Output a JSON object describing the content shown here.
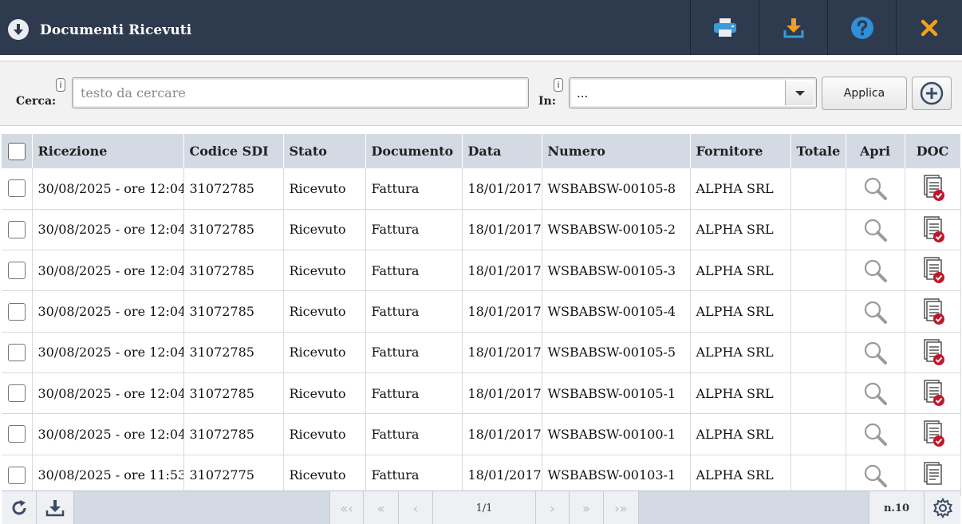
{
  "window": {
    "title": "Documenti Ricevuti",
    "buttons": [
      "print-icon",
      "download-icon",
      "help-icon",
      "close-icon"
    ]
  },
  "search": {
    "label": "Cerca:",
    "info": "i",
    "placeholder": "testo da cercare",
    "value": "",
    "in_label": "In:",
    "in_info": "i",
    "in_value": "...",
    "apply_label": "Applica"
  },
  "table": {
    "columns": [
      "Ricezione",
      "Codice SDI",
      "Stato",
      "Documento",
      "Data",
      "Numero",
      "Fornitore",
      "Totale",
      "Apri",
      "DOC"
    ],
    "rows": [
      {
        "ricezione": "30/08/2025 - ore 12:04",
        "codice": "31072785",
        "stato": "Ricevuto",
        "documento": "Fattura",
        "data": "18/01/2017",
        "numero": "WSBABSW-00105-8",
        "fornitore": "ALPHA SRL",
        "totale": "",
        "doc_icon": "document-check-icon"
      },
      {
        "ricezione": "30/08/2025 - ore 12:04",
        "codice": "31072785",
        "stato": "Ricevuto",
        "documento": "Fattura",
        "data": "18/01/2017",
        "numero": "WSBABSW-00105-2",
        "fornitore": "ALPHA SRL",
        "totale": "",
        "doc_icon": "document-check-icon"
      },
      {
        "ricezione": "30/08/2025 - ore 12:04",
        "codice": "31072785",
        "stato": "Ricevuto",
        "documento": "Fattura",
        "data": "18/01/2017",
        "numero": "WSBABSW-00105-3",
        "fornitore": "ALPHA SRL",
        "totale": "",
        "doc_icon": "document-check-icon"
      },
      {
        "ricezione": "30/08/2025 - ore 12:04",
        "codice": "31072785",
        "stato": "Ricevuto",
        "documento": "Fattura",
        "data": "18/01/2017",
        "numero": "WSBABSW-00105-4",
        "fornitore": "ALPHA SRL",
        "totale": "",
        "doc_icon": "document-check-icon"
      },
      {
        "ricezione": "30/08/2025 - ore 12:04",
        "codice": "31072785",
        "stato": "Ricevuto",
        "documento": "Fattura",
        "data": "18/01/2017",
        "numero": "WSBABSW-00105-5",
        "fornitore": "ALPHA SRL",
        "totale": "",
        "doc_icon": "document-check-icon"
      },
      {
        "ricezione": "30/08/2025 - ore 12:04",
        "codice": "31072785",
        "stato": "Ricevuto",
        "documento": "Fattura",
        "data": "18/01/2017",
        "numero": "WSBABSW-00105-1",
        "fornitore": "ALPHA SRL",
        "totale": "",
        "doc_icon": "document-check-icon"
      },
      {
        "ricezione": "30/08/2025 - ore 12:04",
        "codice": "31072785",
        "stato": "Ricevuto",
        "documento": "Fattura",
        "data": "18/01/2017",
        "numero": "WSBABSW-00100-1",
        "fornitore": "ALPHA SRL",
        "totale": "",
        "doc_icon": "document-check-icon"
      },
      {
        "ricezione": "30/08/2025 - ore 11:53",
        "codice": "31072775",
        "stato": "Ricevuto",
        "documento": "Fattura",
        "data": "18/01/2017",
        "numero": "WSBABSW-00103-1",
        "fornitore": "ALPHA SRL",
        "totale": "",
        "doc_icon": "document-icon"
      }
    ]
  },
  "footer": {
    "page_info": "1/1",
    "count": "n.10",
    "icons": [
      "refresh-icon",
      "export-icon",
      "first-page-icon",
      "fast-back-icon",
      "prev-page-icon",
      "next-page-icon",
      "fast-forward-icon",
      "last-page-icon",
      "settings-gear-icon"
    ],
    "first_glyph": "«‹",
    "fast_back_glyph": "«",
    "prev_glyph": "‹",
    "next_glyph": "›",
    "fast_fwd_glyph": "»",
    "last_glyph": "›»"
  },
  "colors": {
    "titlebar": "#2e3a4d",
    "header": "#d4dae3",
    "accent_orange": "#f0a01e",
    "help_blue": "#2f8fd8",
    "check_red": "#c0182b"
  }
}
